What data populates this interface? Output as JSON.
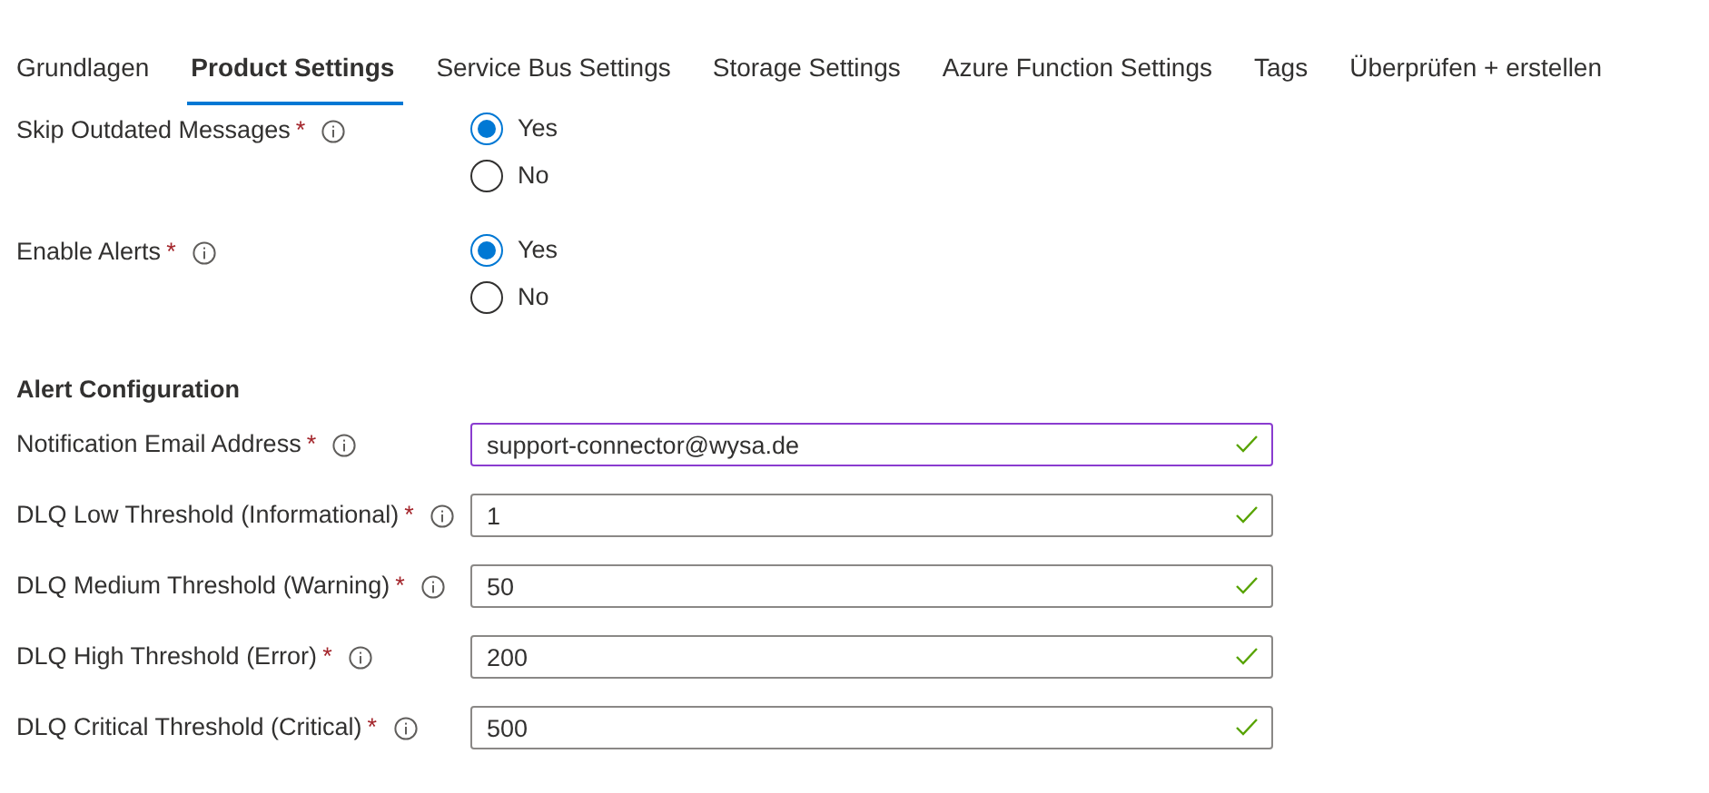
{
  "tabs": [
    {
      "label": "Grundlagen",
      "selected": false
    },
    {
      "label": "Product Settings",
      "selected": true
    },
    {
      "label": "Service Bus Settings",
      "selected": false
    },
    {
      "label": "Storage Settings",
      "selected": false
    },
    {
      "label": "Azure Function Settings",
      "selected": false
    },
    {
      "label": "Tags",
      "selected": false
    },
    {
      "label": "Überprüfen + erstellen",
      "selected": false
    }
  ],
  "radio_groups": [
    {
      "label": "Skip Outdated Messages",
      "required_mark": "*",
      "options": [
        {
          "label": "Yes",
          "selected": true
        },
        {
          "label": "No",
          "selected": false
        }
      ]
    },
    {
      "label": "Enable Alerts",
      "required_mark": "*",
      "options": [
        {
          "label": "Yes",
          "selected": true
        },
        {
          "label": "No",
          "selected": false
        }
      ]
    }
  ],
  "alert_configuration": {
    "heading": "Alert Configuration",
    "fields": [
      {
        "label": "Notification Email Address",
        "required_mark": "*",
        "value": "support-connector@wysa.de",
        "focused": true,
        "valid": true
      },
      {
        "label": "DLQ Low Threshold (Informational)",
        "required_mark": "*",
        "value": "1",
        "focused": false,
        "valid": true
      },
      {
        "label": "DLQ Medium Threshold (Warning)",
        "required_mark": "*",
        "value": "50",
        "focused": false,
        "valid": true
      },
      {
        "label": "DLQ High Threshold (Error)",
        "required_mark": "*",
        "value": "200",
        "focused": false,
        "valid": true
      },
      {
        "label": "DLQ Critical Threshold (Critical)",
        "required_mark": "*",
        "value": "500",
        "focused": false,
        "valid": true
      }
    ]
  }
}
